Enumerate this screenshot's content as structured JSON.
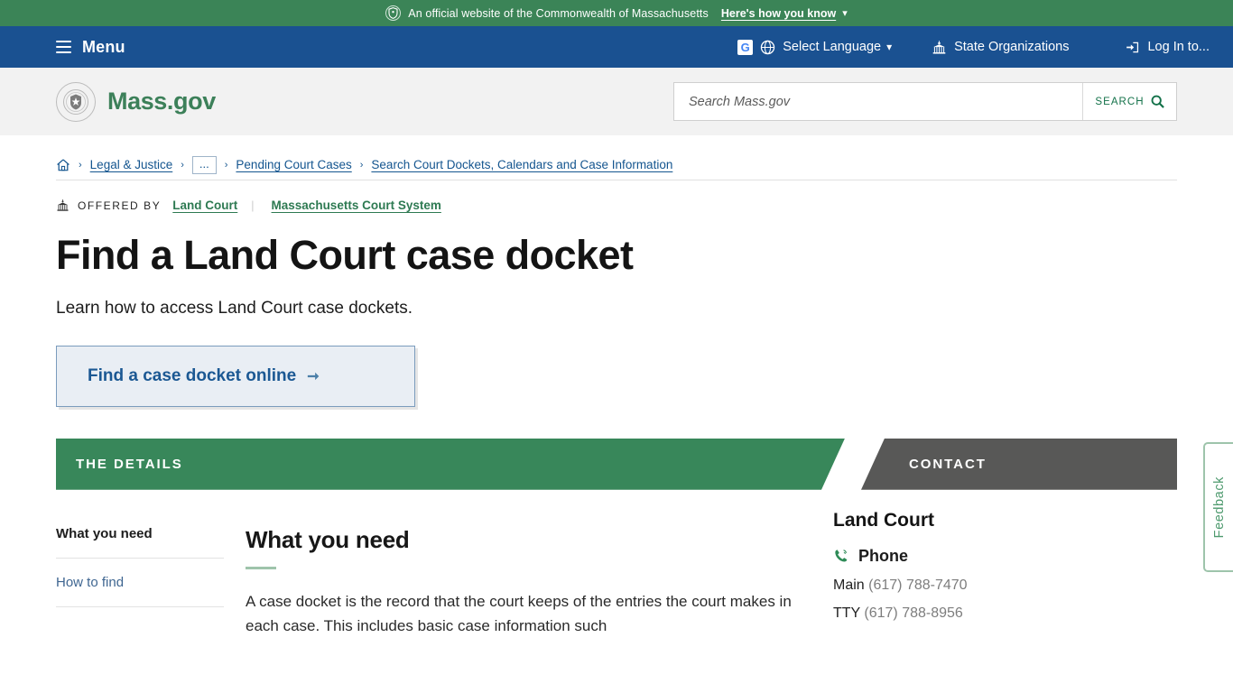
{
  "gov_banner": {
    "text": "An official website of the Commonwealth of Massachusetts",
    "how_you_know": "Here's how you know",
    "seal_icon": "state-seal-icon",
    "chevron_icon": "chevron-down-icon",
    "background_color": "#3b8457"
  },
  "mainnav": {
    "menu_label": "Menu",
    "menu_icon": "hamburger-icon",
    "background_color": "#1a5191",
    "items": [
      {
        "label": "Select Language",
        "icon": "globe-icon",
        "badge_icon": "google-logo-icon",
        "caret": "chevron-down-icon"
      },
      {
        "label": "State Organizations",
        "icon": "capitol-building-icon"
      },
      {
        "label": "Log In to...",
        "icon": "login-arrow-icon"
      }
    ]
  },
  "header": {
    "brand_name": "Mass.gov",
    "brand_icon": "state-seal-icon",
    "brand_color": "#3c8059",
    "search": {
      "placeholder": "Search Mass.gov",
      "value": "",
      "button_label": "SEARCH",
      "button_icon": "search-icon"
    }
  },
  "breadcrumb": {
    "home_icon": "home-icon",
    "separator": "›",
    "ellipsis": "...",
    "items": [
      {
        "label": "Legal & Justice"
      },
      {
        "label": "Pending Court Cases"
      },
      {
        "label": "Search Court Dockets, Calendars and Case Information"
      }
    ]
  },
  "offered_by": {
    "icon": "capitol-building-icon",
    "label": "OFFERED BY",
    "links": [
      "Land Court",
      "Massachusetts Court System"
    ]
  },
  "page": {
    "title": "Find a Land Court case docket",
    "subtitle": "Learn how to access Land Court case dockets.",
    "cta": {
      "label": "Find a case docket online",
      "arrow_icon": "arrow-right-icon"
    }
  },
  "banners": {
    "details": {
      "label": "THE DETAILS",
      "color": "#38875a"
    },
    "contact": {
      "label": "CONTACT",
      "color": "#585857"
    }
  },
  "sidenav": {
    "items": [
      {
        "label": "What you need",
        "active": true
      },
      {
        "label": "How to find",
        "active": false
      }
    ]
  },
  "main_section": {
    "heading": "What you need",
    "body": "A case docket is the record that the court keeps of the entries the court makes in each case. This includes basic case information such"
  },
  "contact": {
    "org": "Land Court",
    "phone_heading": "Phone",
    "phone_icon": "phone-icon",
    "rows": [
      {
        "label": "Main",
        "number": "(617) 788-7470"
      },
      {
        "label": "TTY",
        "number": "(617) 788-8956"
      }
    ]
  },
  "feedback": {
    "label": "Feedback",
    "color": "#4e9a6e"
  }
}
